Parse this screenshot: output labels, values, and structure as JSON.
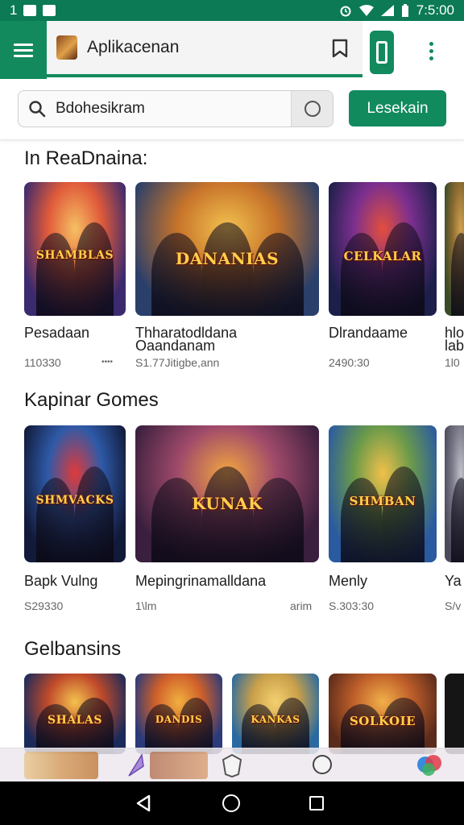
{
  "status_bar": {
    "left_text": "1",
    "time": "7:5:00"
  },
  "app_bar": {
    "title": "Aplikacenan"
  },
  "search": {
    "value": "Bdohesikram",
    "button_label": "Lesekain"
  },
  "sections": [
    {
      "title": "In ReaDnaina:",
      "cards": [
        {
          "name": "Pesadaan",
          "name2": "",
          "price": "110330",
          "price_right": "••••",
          "art_text": "SHAMBLAS",
          "palette": [
            "#3c2a6e",
            "#e05a3a",
            "#f6c063"
          ]
        },
        {
          "name": "Thharatodldana",
          "name2": "Oaandanam",
          "price": "S1.77Jitigbe,ann",
          "price_right": "",
          "art_text": "DANANIAS",
          "palette": [
            "#2a3f6a",
            "#c8742a",
            "#f3c24f"
          ]
        },
        {
          "name": "Dlrandaame",
          "name2": "",
          "price": "2490:30",
          "price_right": "",
          "art_text": "CELKALAR",
          "palette": [
            "#1d1f4a",
            "#7b2f8f",
            "#e24f3c"
          ]
        },
        {
          "name": "hlo",
          "name2": "lab",
          "price": "1l0",
          "price_right": "",
          "art_text": "",
          "palette": [
            "#3a4a2a",
            "#8a6a30",
            "#d0a050"
          ]
        }
      ]
    },
    {
      "title": "Kapinar Gomes",
      "cards": [
        {
          "name": "Bapk Vulng",
          "name2": "",
          "price": "S29330",
          "price_right": "",
          "art_text": "SHMVACKS",
          "palette": [
            "#121a3a",
            "#2e5aa8",
            "#e03a3a"
          ]
        },
        {
          "name": "Mepingrinamalldana",
          "name2": "",
          "price": "1\\lm",
          "price_right": "arim",
          "art_text": "KUNAK",
          "palette": [
            "#3a1f3e",
            "#a04a6a",
            "#f2a640"
          ]
        },
        {
          "name": "Menly",
          "name2": "",
          "price": "S.303:30",
          "price_right": "",
          "art_text": "SHMBAN",
          "palette": [
            "#2a5aa0",
            "#6a9a4a",
            "#f1c04a"
          ]
        },
        {
          "name": "Ya",
          "name2": "",
          "price": "S/v",
          "price_right": "",
          "art_text": "",
          "palette": [
            "#4a4a5a",
            "#7a7a8a",
            "#c0c0c8"
          ]
        }
      ]
    },
    {
      "title": "Gelbansins",
      "cards": [
        {
          "name": "",
          "name2": "",
          "price": "",
          "price_right": "",
          "art_text": "SHALAS",
          "palette": [
            "#1a2a5a",
            "#c04a2a",
            "#f4c24e"
          ]
        },
        {
          "name": "",
          "name2": "",
          "price": "",
          "price_right": "",
          "art_text": "DANDIS",
          "palette": [
            "#2a3a7a",
            "#d0602a",
            "#f0b040"
          ]
        },
        {
          "name": "",
          "name2": "",
          "price": "",
          "price_right": "",
          "art_text": "KANKAS",
          "palette": [
            "#2a6aa0",
            "#caa04a",
            "#f4d070"
          ]
        },
        {
          "name": "",
          "name2": "",
          "price": "",
          "price_right": "",
          "art_text": "SOLKOIE",
          "palette": [
            "#5a2a1a",
            "#c0602a",
            "#f2b04a"
          ]
        }
      ]
    }
  ]
}
